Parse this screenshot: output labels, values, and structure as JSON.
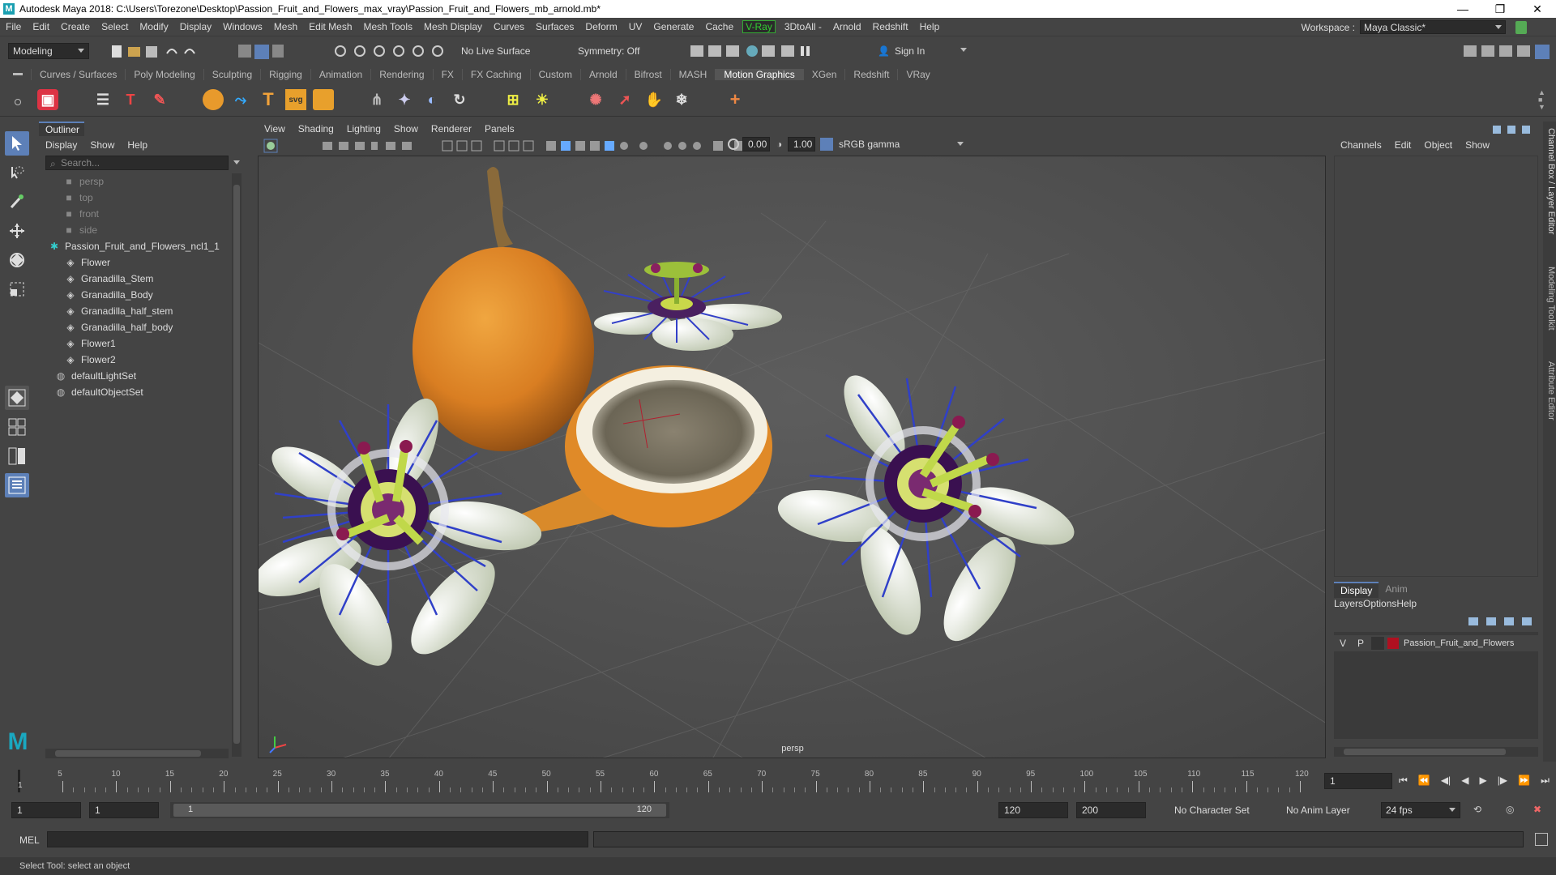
{
  "window": {
    "title": "Autodesk Maya 2018: C:\\Users\\Torezone\\Desktop\\Passion_Fruit_and_Flowers_max_vray\\Passion_Fruit_and_Flowers_mb_arnold.mb*",
    "logo": "M"
  },
  "menubar": {
    "items": [
      "File",
      "Edit",
      "Create",
      "Select",
      "Modify",
      "Display",
      "Windows",
      "Mesh",
      "Edit Mesh",
      "Mesh Tools",
      "Mesh Display",
      "Curves",
      "Surfaces",
      "Deform",
      "UV",
      "Generate",
      "Cache",
      "V-Ray",
      "3DtoAll -",
      "Arnold",
      "Redshift",
      "Help"
    ]
  },
  "workspace": {
    "label": "Workspace :",
    "value": "Maya Classic*"
  },
  "statusline": {
    "mode": "Modeling",
    "live_surface": "No Live Surface",
    "symmetry": "Symmetry: Off",
    "sign_in": "Sign In"
  },
  "shelf": {
    "tabs": [
      "Curves / Surfaces",
      "Poly Modeling",
      "Sculpting",
      "Rigging",
      "Animation",
      "Rendering",
      "FX",
      "FX Caching",
      "Custom",
      "Arnold",
      "Bifrost",
      "MASH",
      "Motion Graphics",
      "XGen",
      "Redshift",
      "VRay"
    ],
    "active_tab": "Motion Graphics",
    "icon_texts": {
      "text_tool": "T",
      "svg": "svg",
      "text2": "T"
    }
  },
  "outliner": {
    "title": "Outliner",
    "menu": [
      "Display",
      "Show",
      "Help"
    ],
    "search_placeholder": "Search...",
    "cameras": [
      "persp",
      "top",
      "front",
      "side"
    ],
    "group": "Passion_Fruit_and_Flowers_ncl1_1",
    "children": [
      "Flower",
      "Granadilla_Stem",
      "Granadilla_Body",
      "Granadilla_half_stem",
      "Granadilla_half_body",
      "Flower1",
      "Flower2"
    ],
    "sets": [
      "defaultLightSet",
      "defaultObjectSet"
    ]
  },
  "viewport": {
    "menu": [
      "View",
      "Shading",
      "Lighting",
      "Show",
      "Renderer",
      "Panels"
    ],
    "exposure": "0.00",
    "gamma": "1.00",
    "color_space": "sRGB gamma",
    "camera_label": "persp"
  },
  "channelbox": {
    "menu": [
      "Channels",
      "Edit",
      "Object",
      "Show"
    ]
  },
  "side_tabs": [
    "Channel Box / Layer Editor",
    "Modeling Toolkit",
    "Attribute Editor"
  ],
  "layers": {
    "tabs": [
      "Display",
      "Anim"
    ],
    "active_tab": "Display",
    "menu": [
      "Layers",
      "Options",
      "Help"
    ],
    "rows": [
      {
        "v": "V",
        "p": "P",
        "name": "Passion_Fruit_and_Flowers",
        "color": "#b01020"
      }
    ]
  },
  "timeslider": {
    "ticks": [
      5,
      10,
      15,
      20,
      25,
      30,
      35,
      40,
      45,
      50,
      55,
      60,
      65,
      70,
      75,
      80,
      85,
      90,
      95,
      100,
      105,
      110,
      115,
      120
    ],
    "start_frame": "1",
    "current_frame": "1"
  },
  "range": {
    "start": "1",
    "anim_start": "1",
    "slider_start": "1",
    "slider_end": "120",
    "end": "120",
    "anim_end": "200",
    "character_set": "No Character Set",
    "anim_layer": "No Anim Layer",
    "fps": "24 fps"
  },
  "cmdline": {
    "label": "MEL"
  },
  "helpline": {
    "text": "Select Tool: select an object"
  },
  "colors": {
    "accent": "#5d80b8",
    "vray": "#33cc33",
    "layer": "#b01020"
  }
}
